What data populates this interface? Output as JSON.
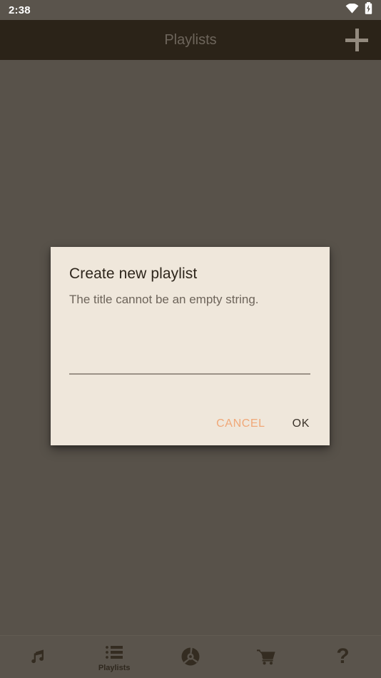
{
  "status_bar": {
    "time": "2:38",
    "icons": [
      {
        "name": "wifi-icon",
        "label": "wifi"
      },
      {
        "name": "battery-charging-icon",
        "label": "battery charging"
      }
    ]
  },
  "app_bar": {
    "title": "Playlists",
    "add_button": {
      "name": "add-playlist-button",
      "icon": "plus-icon",
      "label": "+"
    }
  },
  "dialog": {
    "title": "Create new playlist",
    "message": "The title cannot be an empty string.",
    "input": {
      "value": "",
      "placeholder": ""
    },
    "cancel_label": "CANCEL",
    "ok_label": "OK"
  },
  "bottom_nav": {
    "items": [
      {
        "label": "",
        "icon": "music-note-icon",
        "glyph": "♫",
        "selected": false
      },
      {
        "label": "Playlists",
        "icon": "playlist-list-icon",
        "glyph": "",
        "selected": true
      },
      {
        "label": "",
        "icon": "disc-icon",
        "glyph": "",
        "selected": false
      },
      {
        "label": "",
        "icon": "shopping-cart-icon",
        "glyph": "",
        "selected": false
      },
      {
        "label": "",
        "icon": "help-question-icon",
        "glyph": "?",
        "selected": false
      }
    ]
  },
  "colors": {
    "status_bar_bg": "#5a544c",
    "app_bar_bg": "#2b2318",
    "scrim_bg": "#58524a",
    "dialog_surface": "#efe7db",
    "accent_orange": "#f0a878",
    "title_text": "#2d251b",
    "message_text": "#6d645a",
    "nav_icon": "#342c21"
  }
}
